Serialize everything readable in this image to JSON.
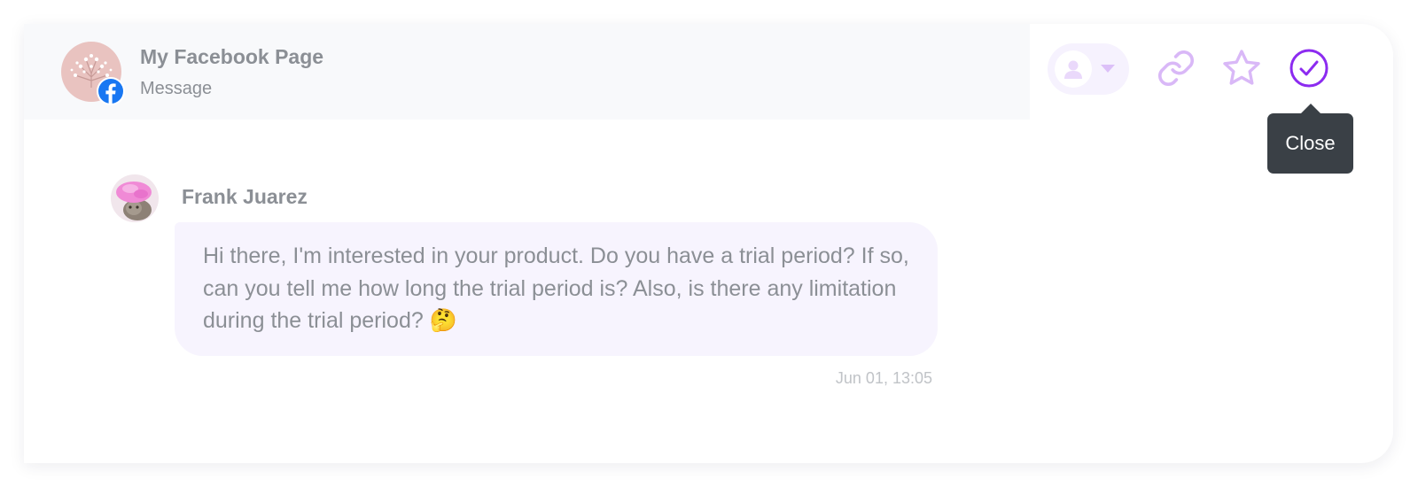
{
  "header": {
    "page_name": "My Facebook Page",
    "channel": "Message",
    "page_avatar_icon": "flower-avatar",
    "platform_icon": "facebook-icon"
  },
  "toolbar": {
    "assignee_icon": "user-icon",
    "assignee_caret_icon": "caret-down-icon",
    "link_icon": "link-icon",
    "star_icon": "star-icon",
    "close_icon": "check-circle-icon",
    "close_tooltip": "Close"
  },
  "message": {
    "sender_name": "Frank Juarez",
    "sender_avatar_icon": "cat-avatar",
    "text": "Hi there, I'm interested in your product. Do you have a trial period? If so, can you tell me how long the trial period is? Also, is there any limitation during the trial period? 🤔",
    "timestamp": "Jun 01, 13:05"
  },
  "colors": {
    "accent": "#8c2bf0",
    "accent_light": "#d9b8f7",
    "bubble_bg": "#f7f4fe",
    "facebook_blue": "#1877f2",
    "tooltip_bg": "#3a4046"
  }
}
